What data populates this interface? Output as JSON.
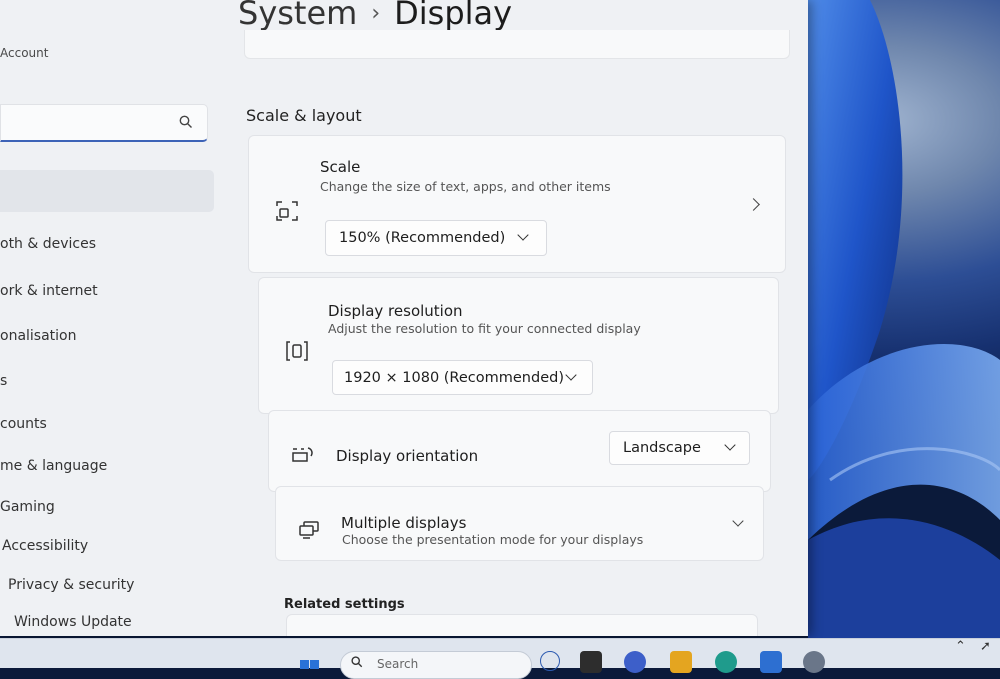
{
  "window": {
    "breadcrumb_parent": "System",
    "breadcrumb_sep": "›",
    "page_title": "Display"
  },
  "sidebar": {
    "account_label": "Account",
    "search_placeholder": "",
    "items": [
      {
        "label": "oth & devices"
      },
      {
        "label": "ork & internet"
      },
      {
        "label": "onalisation"
      },
      {
        "label": "s"
      },
      {
        "label": "counts"
      },
      {
        "label": "me & language"
      },
      {
        "label": "Gaming"
      },
      {
        "label": "Accessibility"
      },
      {
        "label": "Privacy & security"
      },
      {
        "label": "Windows Update"
      }
    ]
  },
  "main": {
    "section_heading": "Scale & layout",
    "scale": {
      "title": "Scale",
      "subtitle": "Change the size of text, apps, and other items",
      "value": "150% (Recommended)",
      "icon": "scale-icon"
    },
    "resolution": {
      "title": "Display resolution",
      "subtitle": "Adjust the resolution to fit your connected display",
      "value": "1920 × 1080 (Recommended)",
      "icon": "resolution-icon"
    },
    "orientation": {
      "title": "Display orientation",
      "value": "Landscape",
      "icon": "orientation-icon"
    },
    "multiple_displays": {
      "title": "Multiple displays",
      "subtitle": "Choose the presentation mode for your displays",
      "icon": "multiple-displays-icon"
    },
    "related_heading": "Related settings"
  },
  "taskbar": {
    "search_label": "Search"
  },
  "colors": {
    "accent": "#3d63b7",
    "window_bg": "#eff1f4",
    "card_bg": "#f8f9fa"
  }
}
